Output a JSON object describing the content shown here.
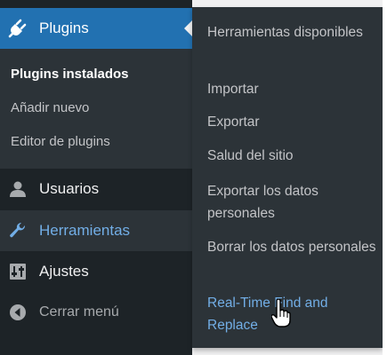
{
  "sidebar": {
    "plugins": {
      "label": "Plugins",
      "icon": "plugin-icon"
    },
    "plugin_submenu": [
      {
        "label": "Plugins instalados",
        "current": true
      },
      {
        "label": "Añadir nuevo",
        "current": false
      },
      {
        "label": "Editor de plugins",
        "current": false
      }
    ],
    "usuarios": {
      "label": "Usuarios",
      "icon": "users-icon"
    },
    "herramientas": {
      "label": "Herramientas",
      "icon": "wrench-icon"
    },
    "ajustes": {
      "label": "Ajustes",
      "icon": "settings-icon"
    },
    "collapse": {
      "label": "Cerrar menú",
      "icon": "collapse-icon"
    }
  },
  "flyout": {
    "items": [
      {
        "label": "Herramientas disponibles"
      },
      {
        "label": "Importar"
      },
      {
        "label": "Exportar"
      },
      {
        "label": "Salud del sitio"
      },
      {
        "label": "Exportar los datos personales"
      },
      {
        "label": "Borrar los datos personales"
      },
      {
        "label": "Real-Time Find and Replace",
        "hovered": true
      }
    ]
  },
  "colors": {
    "sidebar_bg": "#1d2327",
    "submenu_bg": "#2c3338",
    "accent": "#2271b1",
    "link_hover": "#72aee6",
    "text": "#c3c4c7"
  }
}
